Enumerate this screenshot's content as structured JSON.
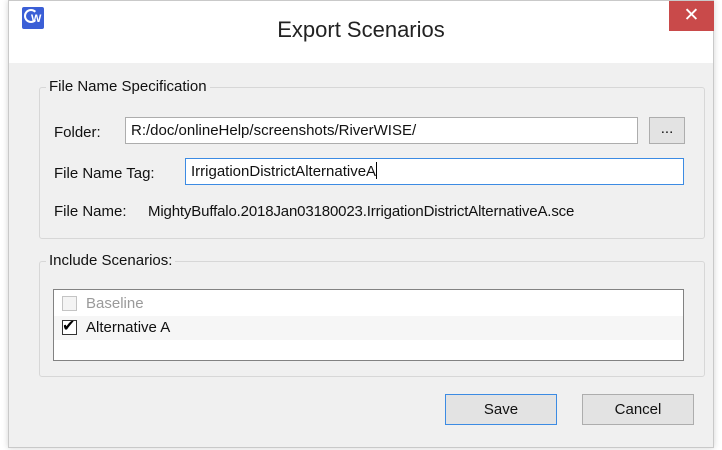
{
  "window": {
    "title": "Export Scenarios",
    "close_glyph": "✕",
    "app_icon": "riverwise-app-icon",
    "app_icon_letter": "W"
  },
  "file_spec": {
    "legend": "File Name Specification",
    "folder_label": "Folder:",
    "folder_value": "R:/doc/onlineHelp/screenshots/RiverWISE/",
    "browse_label": "...",
    "tag_label": "File Name Tag:",
    "tag_value": "IrrigationDistrictAlternativeA",
    "file_name_label": "File Name:",
    "file_name_value": "MightyBuffalo.2018Jan03180023.IrrigationDistrictAlternativeA.sce"
  },
  "scenarios": {
    "legend": "Include Scenarios:",
    "items": [
      {
        "label": "Baseline",
        "checked": false,
        "enabled": false
      },
      {
        "label": "Alternative A",
        "checked": true,
        "enabled": true
      }
    ]
  },
  "buttons": {
    "save": "Save",
    "cancel": "Cancel"
  },
  "colors": {
    "accent": "#3c8be3",
    "close_button": "#c94a4a",
    "dialog_background": "#f0f0f0"
  }
}
